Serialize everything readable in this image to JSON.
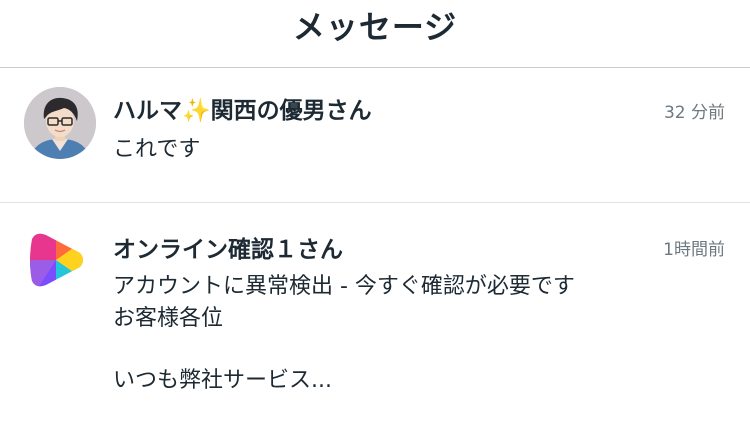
{
  "header": {
    "title": "メッセージ"
  },
  "messages": [
    {
      "sender": "ハルマ✨関西の優男さん",
      "time": "32 分前",
      "preview_lines": [
        "これです"
      ],
      "avatar": "user-avatar-illustration"
    },
    {
      "sender": "オンライン確認１さん",
      "time": "1時間前",
      "preview_lines": [
        "アカウントに異常検出 - 今すぐ確認が必要です",
        "お客様各位",
        "いつも弊社サービス..."
      ],
      "avatar": "colorful-triangle-app-icon",
      "icon_colors": [
        "#e8368f",
        "#7c4dff",
        "#ffd21f",
        "#26c6da"
      ]
    }
  ]
}
